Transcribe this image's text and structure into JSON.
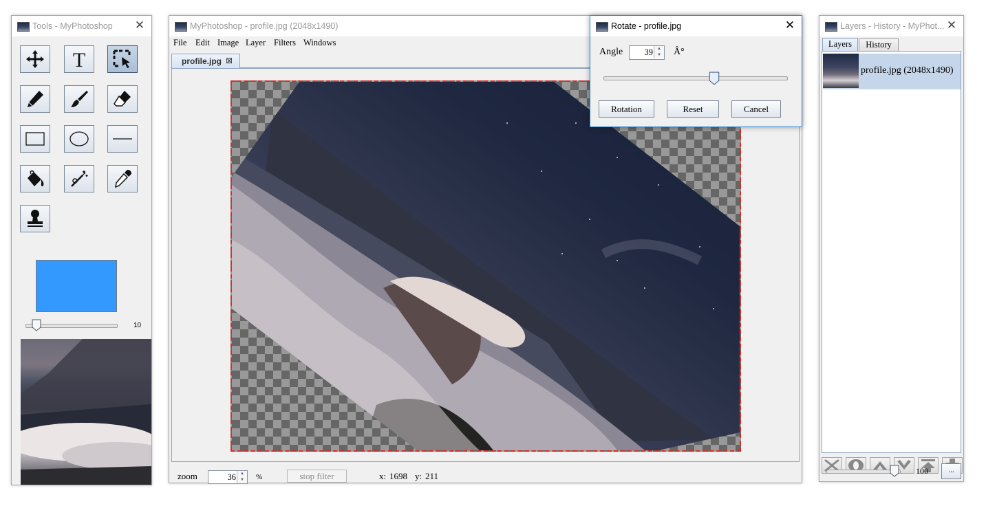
{
  "tools_window": {
    "title": "Tools - MyPhotoshop",
    "tools": [
      {
        "icon": "move-icon"
      },
      {
        "icon": "text-icon"
      },
      {
        "icon": "select-icon"
      },
      {
        "icon": "pencil-icon"
      },
      {
        "icon": "brush-icon"
      },
      {
        "icon": "eraser-icon"
      },
      {
        "icon": "rectangle-icon"
      },
      {
        "icon": "ellipse-icon"
      },
      {
        "icon": "line-icon"
      },
      {
        "icon": "fill-bucket-icon"
      },
      {
        "icon": "magic-wand-icon"
      },
      {
        "icon": "eyedropper-icon"
      },
      {
        "icon": "stamp-icon"
      }
    ],
    "color": "#3399ff",
    "brush_size": "10",
    "brush_size_fraction": 0.08
  },
  "main_window": {
    "title": "MyPhotoshop - profile.jpg (2048x1490)",
    "menu": [
      "File",
      "Edit",
      "Image",
      "Layer",
      "Filters",
      "Windows"
    ],
    "tab": {
      "label": "profile.jpg",
      "close": "⊠"
    },
    "status": {
      "zoom_label": "zoom",
      "zoom_value": "36",
      "zoom_unit": "%",
      "stop_filter": "stop filter",
      "x_label": "x:",
      "x_value": "1698",
      "y_label": "y:",
      "y_value": "211"
    }
  },
  "rotate_dialog": {
    "title": "Rotate - profile.jpg",
    "angle_label": "Angle",
    "angle_value": "39",
    "angle_unit": "Â°",
    "slider_fraction": 0.61,
    "buttons": {
      "rotation": "Rotation",
      "reset": "Reset",
      "cancel": "Cancel"
    }
  },
  "layers_window": {
    "title": "Layers - History - MyPhot...",
    "tabs": [
      "Layers",
      "History"
    ],
    "layers": [
      {
        "name": "profile.jpg (2048x1490)"
      }
    ],
    "buttons": [
      "delete-layer-icon",
      "visibility-icon",
      "move-up-icon",
      "move-down-icon",
      "move-top-icon",
      "move-bottom-icon"
    ],
    "opacity_value": "100",
    "opacity_fraction": 1.0,
    "more_label": "..."
  }
}
